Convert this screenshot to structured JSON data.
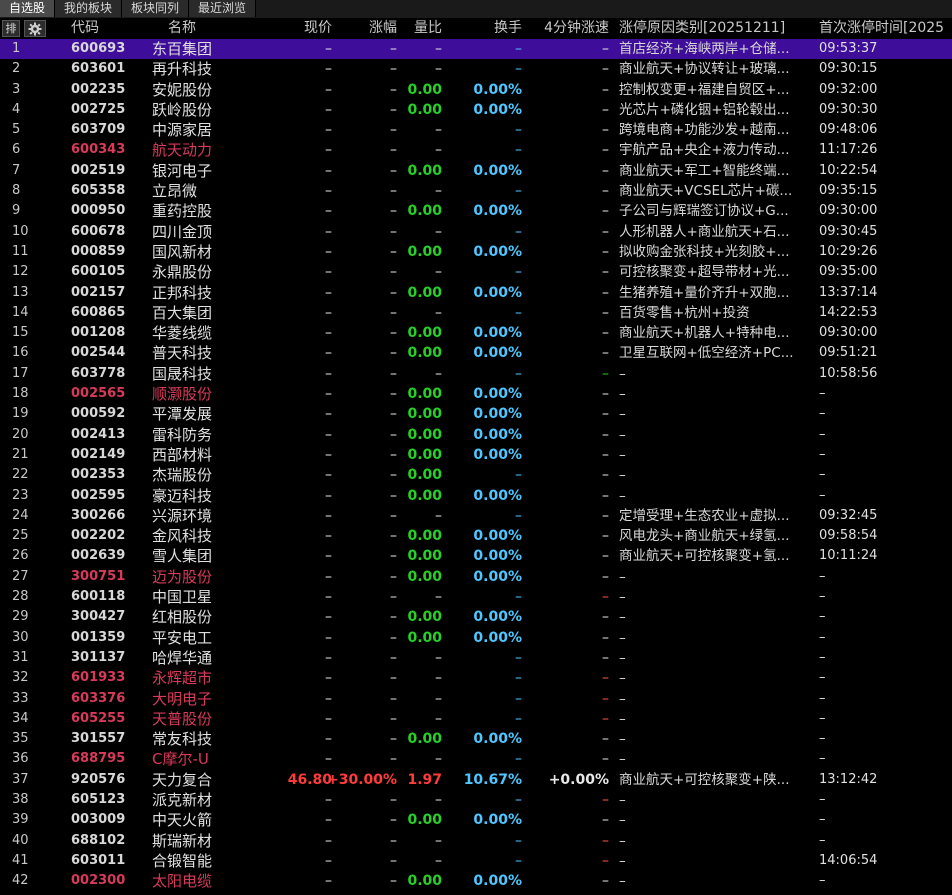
{
  "tabs": [
    "自选股",
    "我的板块",
    "板块同列",
    "最近浏览"
  ],
  "header": {
    "sort_icon_label": "排",
    "code": "代码",
    "name": "名称",
    "price": "现价",
    "change": "涨幅",
    "vol_ratio": "量比",
    "turnover": "换手",
    "speed": "4分钟涨速",
    "reason": "涨停原因类别[20251211]",
    "first_time": "首次涨停时间[2025"
  },
  "colors": {
    "selected_row": "#3e0e9a",
    "red": "#ff3b3b",
    "pink_name": "#d83a5a",
    "green": "#25d225",
    "cyan": "#4fc6ff"
  },
  "rows": [
    {
      "idx": "1",
      "code": "600693",
      "name": "东百集团",
      "price": "–",
      "chg": "–",
      "vr": "–",
      "to": "–",
      "spd": "–",
      "reason": "首店经济+海峡两岸+仓储...",
      "time": "09:53:37",
      "selected": true,
      "st": "n"
    },
    {
      "idx": "2",
      "code": "603601",
      "name": "再升科技",
      "price": "–",
      "chg": "–",
      "vr": "–",
      "to": "–",
      "spd": "–",
      "reason": "商业航天+协议转让+玻璃...",
      "time": "09:30:15",
      "st": "n"
    },
    {
      "idx": "3",
      "code": "002235",
      "name": "安妮股份",
      "price": "–",
      "chg": "–",
      "vr": "0.00",
      "to": "0.00%",
      "spd": "–",
      "reason": "控制权变更+福建自贸区+...",
      "time": "09:32:00",
      "st": "n"
    },
    {
      "idx": "4",
      "code": "002725",
      "name": "跃岭股份",
      "price": "–",
      "chg": "–",
      "vr": "0.00",
      "to": "0.00%",
      "spd": "–",
      "reason": "光芯片+磷化铟+铝轮毂出...",
      "time": "09:30:30",
      "st": "n"
    },
    {
      "idx": "5",
      "code": "603709",
      "name": "中源家居",
      "price": "–",
      "chg": "–",
      "vr": "–",
      "to": "–",
      "spd": "–",
      "reason": "跨境电商+功能沙发+越南...",
      "time": "09:48:06",
      "st": "n"
    },
    {
      "idx": "6",
      "code": "600343",
      "name": "航天动力",
      "price": "–",
      "chg": "–",
      "vr": "–",
      "to": "–",
      "spd": "–",
      "reason": "宇航产品+央企+液力传动...",
      "time": "11:17:26",
      "st": "p"
    },
    {
      "idx": "7",
      "code": "002519",
      "name": "银河电子",
      "price": "–",
      "chg": "–",
      "vr": "0.00",
      "to": "0.00%",
      "spd": "–",
      "reason": "商业航天+军工+智能终端...",
      "time": "10:22:54",
      "st": "n"
    },
    {
      "idx": "8",
      "code": "605358",
      "name": "立昂微",
      "price": "–",
      "chg": "–",
      "vr": "–",
      "to": "–",
      "spd": "–",
      "reason": "商业航天+VCSEL芯片+碳...",
      "time": "09:35:15",
      "st": "n"
    },
    {
      "idx": "9",
      "code": "000950",
      "name": "重药控股",
      "price": "–",
      "chg": "–",
      "vr": "0.00",
      "to": "0.00%",
      "spd": "–",
      "reason": "子公司与辉瑞签订协议+G...",
      "time": "09:30:00",
      "st": "n"
    },
    {
      "idx": "10",
      "code": "600678",
      "name": "四川金顶",
      "price": "–",
      "chg": "–",
      "vr": "–",
      "to": "–",
      "spd": "–",
      "reason": "人形机器人+商业航天+石...",
      "time": "09:30:45",
      "st": "n"
    },
    {
      "idx": "11",
      "code": "000859",
      "name": "国风新材",
      "price": "–",
      "chg": "–",
      "vr": "0.00",
      "to": "0.00%",
      "spd": "–",
      "reason": "拟收购金张科技+光刻胶+...",
      "time": "10:29:26",
      "st": "n"
    },
    {
      "idx": "12",
      "code": "600105",
      "name": "永鼎股份",
      "price": "–",
      "chg": "–",
      "vr": "–",
      "to": "–",
      "spd": "–",
      "reason": "可控核聚变+超导带材+光...",
      "time": "09:35:00",
      "st": "n"
    },
    {
      "idx": "13",
      "code": "002157",
      "name": "正邦科技",
      "price": "–",
      "chg": "–",
      "vr": "0.00",
      "to": "0.00%",
      "spd": "–",
      "reason": "生猪养殖+量价齐升+双胞...",
      "time": "13:37:14",
      "st": "n"
    },
    {
      "idx": "14",
      "code": "600865",
      "name": "百大集团",
      "price": "–",
      "chg": "–",
      "vr": "–",
      "to": "–",
      "spd": "–",
      "reason": "百货零售+杭州+投资",
      "time": "14:22:53",
      "st": "n"
    },
    {
      "idx": "15",
      "code": "001208",
      "name": "华菱线缆",
      "price": "–",
      "chg": "–",
      "vr": "0.00",
      "to": "0.00%",
      "spd": "–",
      "reason": "商业航天+机器人+特种电...",
      "time": "09:30:00",
      "st": "n"
    },
    {
      "idx": "16",
      "code": "002544",
      "name": "普天科技",
      "price": "–",
      "chg": "–",
      "vr": "0.00",
      "to": "0.00%",
      "spd": "–",
      "reason": "卫星互联网+低空经济+PC...",
      "time": "09:51:21",
      "st": "n"
    },
    {
      "idx": "17",
      "code": "603778",
      "name": "国晟科技",
      "price": "–",
      "chg": "–",
      "vr": "–",
      "to": "–",
      "spd": "–",
      "reason": "–",
      "time": "10:58:56",
      "st": "n",
      "spdc": "g"
    },
    {
      "idx": "18",
      "code": "002565",
      "name": "顺灏股份",
      "price": "–",
      "chg": "–",
      "vr": "0.00",
      "to": "0.00%",
      "spd": "–",
      "reason": "–",
      "time": "–",
      "st": "p"
    },
    {
      "idx": "19",
      "code": "000592",
      "name": "平潭发展",
      "price": "–",
      "chg": "–",
      "vr": "0.00",
      "to": "0.00%",
      "spd": "–",
      "reason": "–",
      "time": "–",
      "st": "n"
    },
    {
      "idx": "20",
      "code": "002413",
      "name": "雷科防务",
      "price": "–",
      "chg": "–",
      "vr": "0.00",
      "to": "0.00%",
      "spd": "–",
      "reason": "–",
      "time": "–",
      "st": "n"
    },
    {
      "idx": "21",
      "code": "002149",
      "name": "西部材料",
      "price": "–",
      "chg": "–",
      "vr": "0.00",
      "to": "0.00%",
      "spd": "–",
      "reason": "–",
      "time": "–",
      "st": "n"
    },
    {
      "idx": "22",
      "code": "002353",
      "name": "杰瑞股份",
      "price": "–",
      "chg": "–",
      "vr": "0.00",
      "to": "–",
      "spd": "–",
      "reason": "–",
      "time": "–",
      "st": "n"
    },
    {
      "idx": "23",
      "code": "002595",
      "name": "豪迈科技",
      "price": "–",
      "chg": "–",
      "vr": "0.00",
      "to": "0.00%",
      "spd": "–",
      "reason": "–",
      "time": "–",
      "st": "n"
    },
    {
      "idx": "24",
      "code": "300266",
      "name": "兴源环境",
      "price": "–",
      "chg": "–",
      "vr": "–",
      "to": "–",
      "spd": "–",
      "reason": "定增受理+生态农业+虚拟...",
      "time": "09:32:45",
      "st": "n"
    },
    {
      "idx": "25",
      "code": "002202",
      "name": "金风科技",
      "price": "–",
      "chg": "–",
      "vr": "0.00",
      "to": "0.00%",
      "spd": "–",
      "reason": "风电龙头+商业航天+绿氢...",
      "time": "09:58:54",
      "st": "n"
    },
    {
      "idx": "26",
      "code": "002639",
      "name": "雪人集团",
      "price": "–",
      "chg": "–",
      "vr": "0.00",
      "to": "0.00%",
      "spd": "–",
      "reason": "商业航天+可控核聚变+氢...",
      "time": "10:11:24",
      "st": "n"
    },
    {
      "idx": "27",
      "code": "300751",
      "name": "迈为股份",
      "price": "–",
      "chg": "–",
      "vr": "0.00",
      "to": "0.00%",
      "spd": "–",
      "reason": "–",
      "time": "–",
      "st": "p"
    },
    {
      "idx": "28",
      "code": "600118",
      "name": "中国卫星",
      "price": "–",
      "chg": "–",
      "vr": "–",
      "to": "–",
      "spd": "–",
      "reason": "–",
      "time": "–",
      "st": "n",
      "spdc": "r"
    },
    {
      "idx": "29",
      "code": "300427",
      "name": "红相股份",
      "price": "–",
      "chg": "–",
      "vr": "0.00",
      "to": "0.00%",
      "spd": "–",
      "reason": "–",
      "time": "–",
      "st": "n"
    },
    {
      "idx": "30",
      "code": "001359",
      "name": "平安电工",
      "price": "–",
      "chg": "–",
      "vr": "0.00",
      "to": "0.00%",
      "spd": "–",
      "reason": "–",
      "time": "–",
      "st": "n"
    },
    {
      "idx": "31",
      "code": "301137",
      "name": "哈焊华通",
      "price": "–",
      "chg": "–",
      "vr": "–",
      "to": "–",
      "spd": "–",
      "reason": "–",
      "time": "–",
      "st": "n"
    },
    {
      "idx": "32",
      "code": "601933",
      "name": "永辉超市",
      "price": "–",
      "chg": "–",
      "vr": "–",
      "to": "–",
      "spd": "–",
      "reason": "–",
      "time": "–",
      "st": "p",
      "spdc": "r"
    },
    {
      "idx": "33",
      "code": "603376",
      "name": "大明电子",
      "price": "–",
      "chg": "–",
      "vr": "–",
      "to": "–",
      "spd": "–",
      "reason": "–",
      "time": "–",
      "st": "p",
      "spdc": "r"
    },
    {
      "idx": "34",
      "code": "605255",
      "name": "天普股份",
      "price": "–",
      "chg": "–",
      "vr": "–",
      "to": "–",
      "spd": "–",
      "reason": "–",
      "time": "–",
      "st": "p",
      "spdc": "r"
    },
    {
      "idx": "35",
      "code": "301557",
      "name": "常友科技",
      "price": "–",
      "chg": "–",
      "vr": "0.00",
      "to": "0.00%",
      "spd": "–",
      "reason": "–",
      "time": "–",
      "st": "n"
    },
    {
      "idx": "36",
      "code": "688795",
      "name": "C摩尔-U",
      "price": "–",
      "chg": "–",
      "vr": "–",
      "to": "–",
      "spd": "–",
      "reason": "–",
      "time": "–",
      "st": "p"
    },
    {
      "idx": "37",
      "code": "920576",
      "name": "天力复合",
      "price": "46.80",
      "chg": "+30.00%",
      "vr": "1.97",
      "to": "10.67%",
      "spd": "+0.00%",
      "reason": "商业航天+可控核聚变+陕...",
      "time": "13:12:42",
      "st": "n",
      "active": true
    },
    {
      "idx": "38",
      "code": "605123",
      "name": "派克新材",
      "price": "–",
      "chg": "–",
      "vr": "–",
      "to": "–",
      "spd": "–",
      "reason": "–",
      "time": "–",
      "st": "n",
      "spdc": "r"
    },
    {
      "idx": "39",
      "code": "003009",
      "name": "中天火箭",
      "price": "–",
      "chg": "–",
      "vr": "0.00",
      "to": "0.00%",
      "spd": "–",
      "reason": "–",
      "time": "–",
      "st": "n"
    },
    {
      "idx": "40",
      "code": "688102",
      "name": "斯瑞新材",
      "price": "–",
      "chg": "–",
      "vr": "–",
      "to": "–",
      "spd": "–",
      "reason": "–",
      "time": "–",
      "st": "n",
      "spdc": "r"
    },
    {
      "idx": "41",
      "code": "603011",
      "name": "合锻智能",
      "price": "–",
      "chg": "–",
      "vr": "–",
      "to": "–",
      "spd": "–",
      "reason": "–",
      "time": "14:06:54",
      "st": "n",
      "spdc": "r"
    },
    {
      "idx": "42",
      "code": "002300",
      "name": "太阳电缆",
      "price": "–",
      "chg": "–",
      "vr": "0.00",
      "to": "0.00%",
      "spd": "–",
      "reason": "–",
      "time": "–",
      "st": "p"
    }
  ]
}
